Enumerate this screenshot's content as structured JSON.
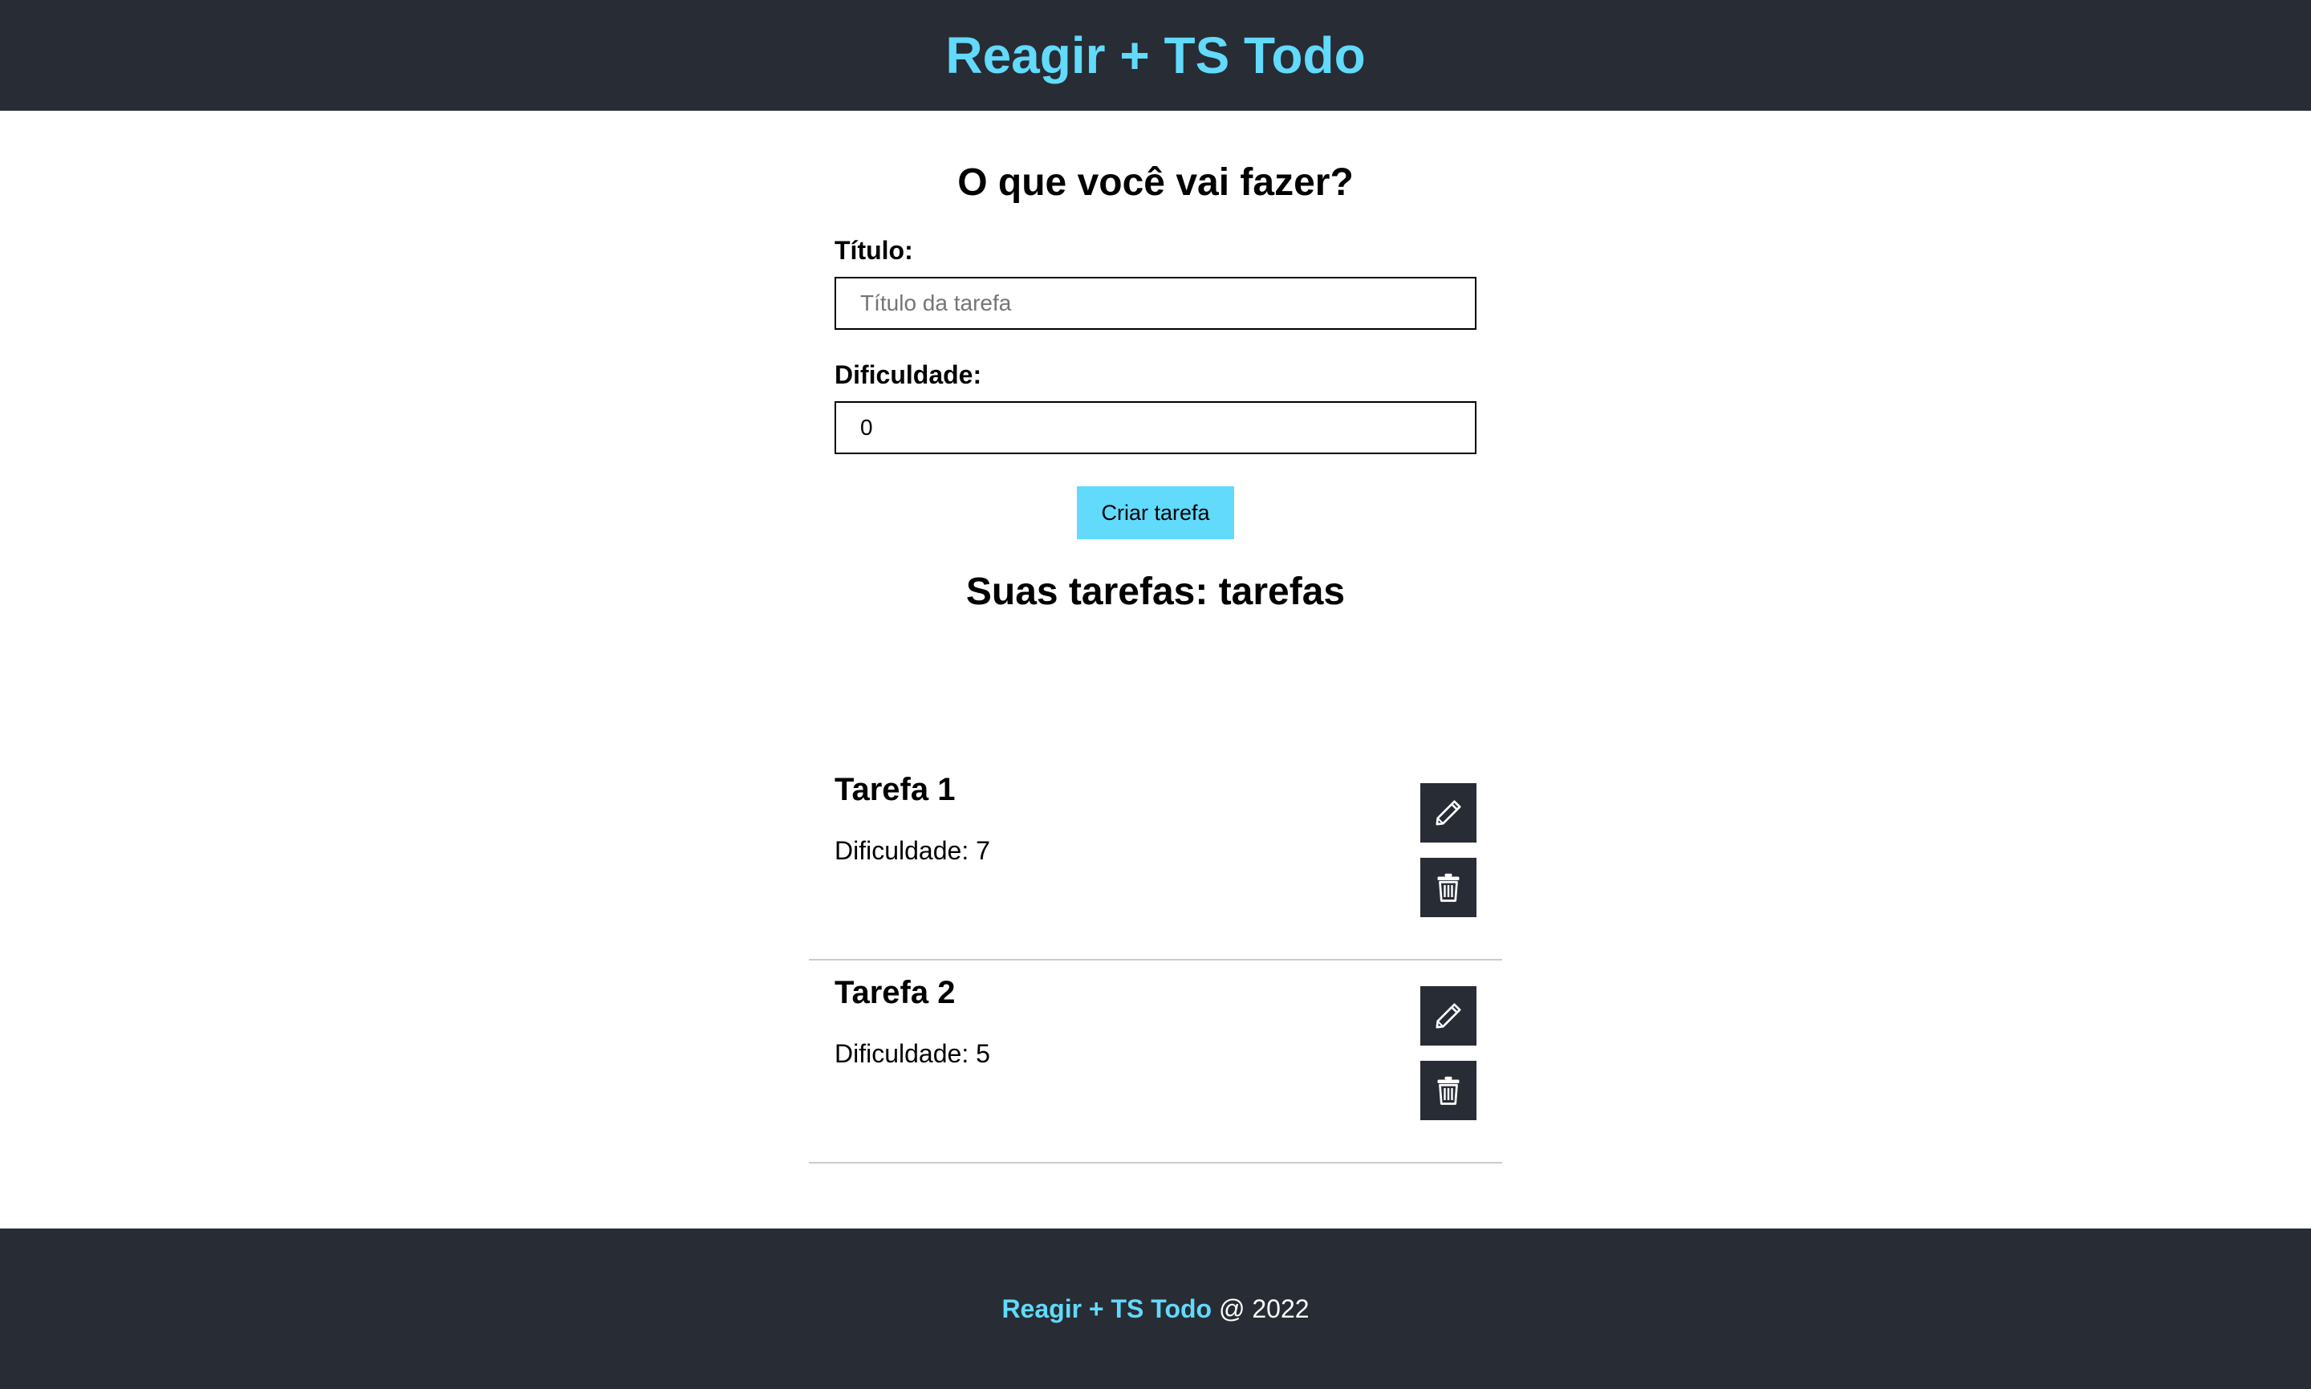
{
  "header": {
    "title": "Reagir + TS Todo"
  },
  "form": {
    "heading": "O que você vai fazer?",
    "title_label": "Título:",
    "title_placeholder": "Título da tarefa",
    "title_value": "",
    "difficulty_label": "Dificuldade:",
    "difficulty_value": "0",
    "submit_label": "Criar tarefa"
  },
  "list": {
    "heading": "Suas tarefas: tarefas",
    "tasks": [
      {
        "title": "Tarefa 1",
        "difficulty": "Dificuldade: 7"
      },
      {
        "title": "Tarefa 2",
        "difficulty": "Dificuldade: 5"
      }
    ],
    "edit_icon": "pencil-icon",
    "delete_icon": "trash-icon"
  },
  "footer": {
    "brand": "Reagir + TS Todo",
    "suffix": "@ 2022"
  },
  "colors": {
    "dark": "#282c34",
    "accent": "#61dafb",
    "divider": "#cccccc"
  }
}
